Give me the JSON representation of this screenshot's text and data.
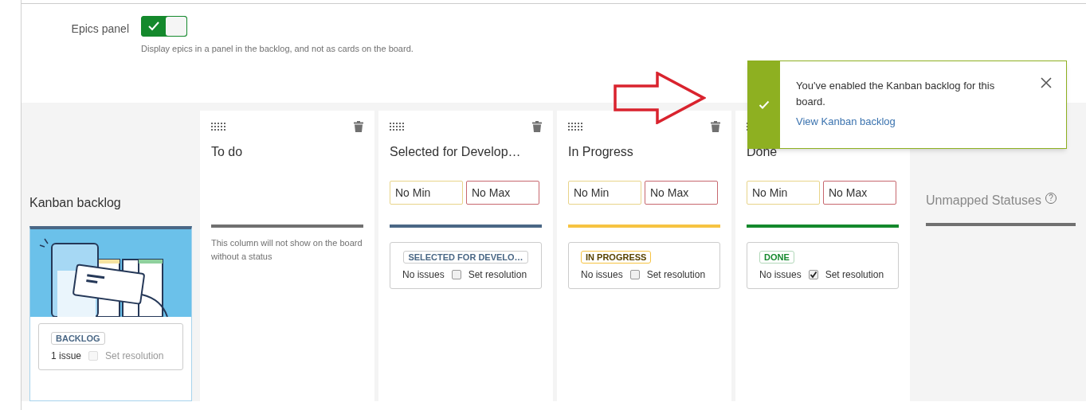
{
  "settings": {
    "epics_panel": {
      "label": "Epics panel",
      "on": true,
      "description": "Display epics in a panel in the backlog, and not as cards on the board."
    }
  },
  "backlog_column": {
    "title": "Kanban backlog",
    "status": {
      "label": "BACKLOG",
      "count": "1 issue",
      "set_resolution": "Set resolution",
      "checked": false,
      "disabled": true
    }
  },
  "columns": [
    {
      "kind": "empty",
      "title": "To do",
      "color": "#707070",
      "note": "This column will not show on the board without a status"
    },
    {
      "kind": "new",
      "title": "Selected for Develop…",
      "min_placeholder": "No Min",
      "max_placeholder": "No Max",
      "color": "#4a6785",
      "status": {
        "label": "SELECTED FOR DEVELO…",
        "count": "No issues",
        "set_resolution": "Set resolution",
        "checked": false,
        "disabled": false
      }
    },
    {
      "kind": "progress",
      "title": "In Progress",
      "min_placeholder": "No Min",
      "max_placeholder": "No Max",
      "color": "#f6c342",
      "status": {
        "label": "IN PROGRESS",
        "count": "No issues",
        "set_resolution": "Set resolution",
        "checked": false,
        "disabled": false
      }
    },
    {
      "kind": "done",
      "title": "Done",
      "min_placeholder": "No Min",
      "max_placeholder": "No Max",
      "color": "#14892c",
      "status": {
        "label": "DONE",
        "count": "No issues",
        "set_resolution": "Set resolution",
        "checked": true,
        "disabled": false
      }
    }
  ],
  "unmapped": {
    "title": "Unmapped Statuses",
    "help_icon": "?"
  },
  "toast": {
    "message": "You've enabled the Kanban backlog for this board.",
    "link": "View Kanban backlog"
  }
}
